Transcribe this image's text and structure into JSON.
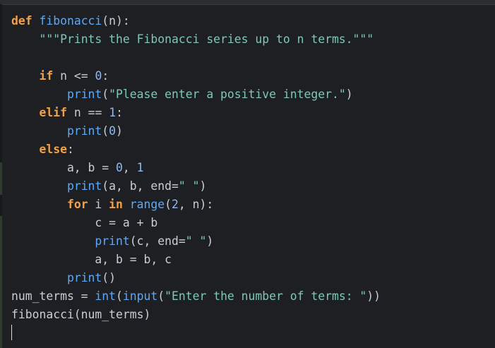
{
  "colors": {
    "background": "#1e1f22",
    "keyword": "#f0a24a",
    "function": "#5fa8f5",
    "string": "#7fc7b8",
    "number": "#8fb8f5",
    "text": "#c9ced6"
  },
  "code_lines": [
    [
      {
        "t": "def",
        "c": "kw"
      },
      {
        "t": " ",
        "c": "txt"
      },
      {
        "t": "fibonacci",
        "c": "fn"
      },
      {
        "t": "(n):",
        "c": "txt"
      }
    ],
    [
      {
        "t": "    ",
        "c": "txt"
      },
      {
        "t": "\"\"\"Prints the Fibonacci series up to n terms.\"\"\"",
        "c": "str"
      }
    ],
    [],
    [
      {
        "t": "    ",
        "c": "txt"
      },
      {
        "t": "if",
        "c": "kw"
      },
      {
        "t": " n <= ",
        "c": "txt"
      },
      {
        "t": "0",
        "c": "num"
      },
      {
        "t": ":",
        "c": "txt"
      }
    ],
    [
      {
        "t": "        ",
        "c": "txt"
      },
      {
        "t": "print",
        "c": "fn"
      },
      {
        "t": "(",
        "c": "txt"
      },
      {
        "t": "\"Please enter a positive integer.\"",
        "c": "str"
      },
      {
        "t": ")",
        "c": "txt"
      }
    ],
    [
      {
        "t": "    ",
        "c": "txt"
      },
      {
        "t": "elif",
        "c": "kw"
      },
      {
        "t": " n == ",
        "c": "txt"
      },
      {
        "t": "1",
        "c": "num"
      },
      {
        "t": ":",
        "c": "txt"
      }
    ],
    [
      {
        "t": "        ",
        "c": "txt"
      },
      {
        "t": "print",
        "c": "fn"
      },
      {
        "t": "(",
        "c": "txt"
      },
      {
        "t": "0",
        "c": "num"
      },
      {
        "t": ")",
        "c": "txt"
      }
    ],
    [
      {
        "t": "    ",
        "c": "txt"
      },
      {
        "t": "else",
        "c": "kw"
      },
      {
        "t": ":",
        "c": "txt"
      }
    ],
    [
      {
        "t": "        a, b = ",
        "c": "txt"
      },
      {
        "t": "0",
        "c": "num"
      },
      {
        "t": ", ",
        "c": "txt"
      },
      {
        "t": "1",
        "c": "num"
      }
    ],
    [
      {
        "t": "        ",
        "c": "txt"
      },
      {
        "t": "print",
        "c": "fn"
      },
      {
        "t": "(a, b, end=",
        "c": "txt"
      },
      {
        "t": "\" \"",
        "c": "str"
      },
      {
        "t": ")",
        "c": "txt"
      }
    ],
    [
      {
        "t": "        ",
        "c": "txt"
      },
      {
        "t": "for",
        "c": "kw"
      },
      {
        "t": " i ",
        "c": "txt"
      },
      {
        "t": "in",
        "c": "kw"
      },
      {
        "t": " ",
        "c": "txt"
      },
      {
        "t": "range",
        "c": "fn"
      },
      {
        "t": "(",
        "c": "txt"
      },
      {
        "t": "2",
        "c": "num"
      },
      {
        "t": ", n):",
        "c": "txt"
      }
    ],
    [
      {
        "t": "            c = a + b",
        "c": "txt"
      }
    ],
    [
      {
        "t": "            ",
        "c": "txt"
      },
      {
        "t": "print",
        "c": "fn"
      },
      {
        "t": "(c, end=",
        "c": "txt"
      },
      {
        "t": "\" \"",
        "c": "str"
      },
      {
        "t": ")",
        "c": "txt"
      }
    ],
    [
      {
        "t": "            a, b = b, c",
        "c": "txt"
      }
    ],
    [
      {
        "t": "        ",
        "c": "txt"
      },
      {
        "t": "print",
        "c": "fn"
      },
      {
        "t": "()",
        "c": "txt"
      }
    ],
    [
      {
        "t": "num_terms = ",
        "c": "txt"
      },
      {
        "t": "int",
        "c": "fn"
      },
      {
        "t": "(",
        "c": "txt"
      },
      {
        "t": "input",
        "c": "fn"
      },
      {
        "t": "(",
        "c": "txt"
      },
      {
        "t": "\"Enter the number of terms: \"",
        "c": "str"
      },
      {
        "t": "))",
        "c": "txt"
      }
    ],
    [
      {
        "t": "fibonacci(num_terms)",
        "c": "txt"
      }
    ]
  ]
}
